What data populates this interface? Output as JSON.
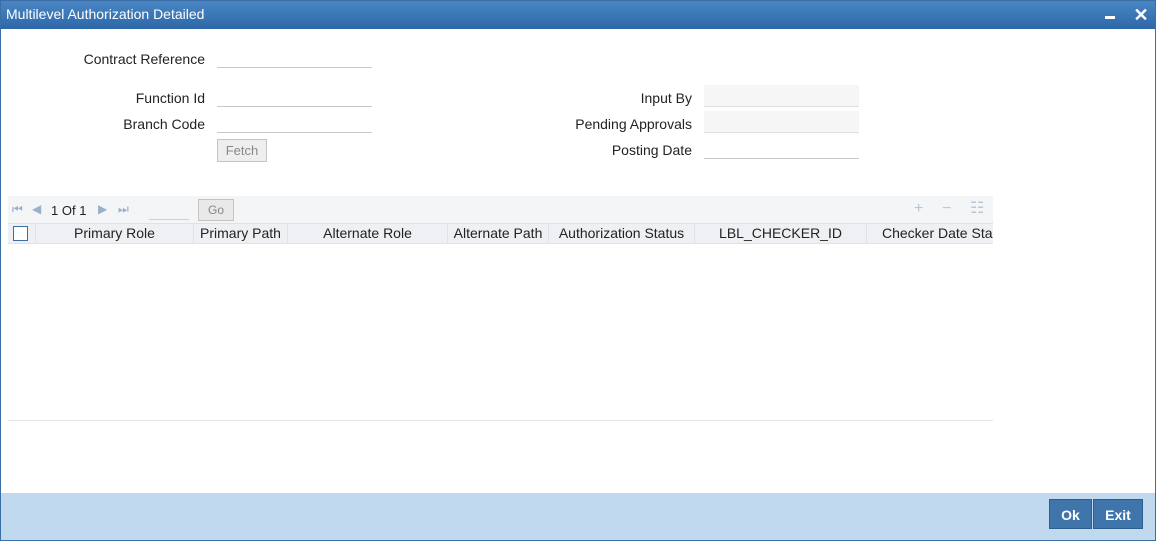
{
  "window": {
    "title": "Multilevel Authorization Detailed",
    "minimize_icon": "minimize-icon",
    "close_icon": "close-icon",
    "close_glyph": "✕"
  },
  "form": {
    "contract_reference": {
      "label": "Contract Reference",
      "value": ""
    },
    "function_id": {
      "label": "Function Id",
      "value": ""
    },
    "branch_code": {
      "label": "Branch Code",
      "value": ""
    },
    "fetch_label": "Fetch",
    "input_by": {
      "label": "Input By",
      "value": ""
    },
    "pending_approvals": {
      "label": "Pending Approvals",
      "value": ""
    },
    "posting_date": {
      "label": "Posting Date",
      "value": ""
    }
  },
  "grid": {
    "pager": {
      "current": "1",
      "of_label": "Of",
      "total": "1",
      "page_input_value": "",
      "go_label": "Go"
    },
    "toolbar_icons": [
      "add-row-icon",
      "delete-row-icon",
      "single-view-icon"
    ],
    "columns": [
      "Primary Role",
      "Primary Path",
      "Alternate Role",
      "Alternate Path",
      "Authorization Status",
      "LBL_CHECKER_ID",
      "Checker Date Stan"
    ],
    "rows": []
  },
  "footer": {
    "ok_label": "Ok",
    "exit_label": "Exit"
  },
  "colors": {
    "titlebar": "#2d67a8",
    "footer": "#c1d9ee",
    "button": "#3f75aa"
  }
}
